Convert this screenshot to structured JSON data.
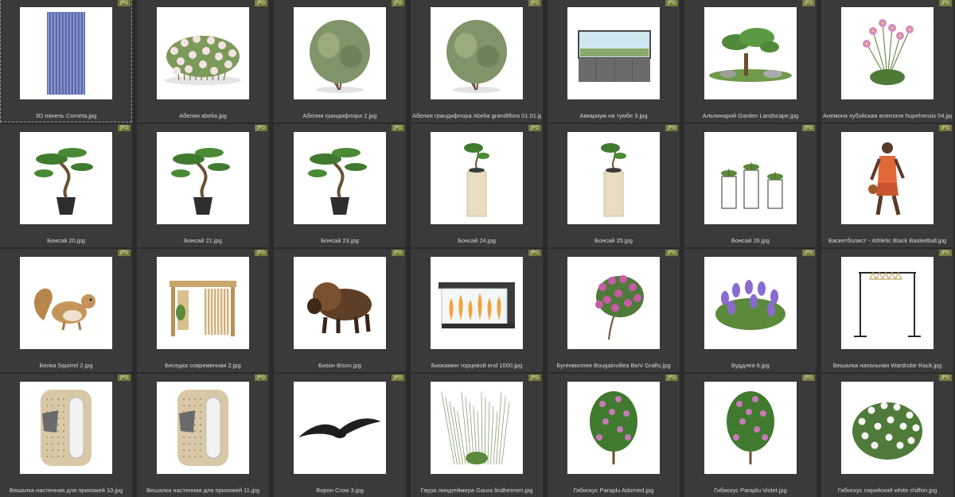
{
  "badge_label": "JPG",
  "files": [
    {
      "name": "3D панель Cometa.jpg",
      "icon": "panel-icon",
      "selected": true
    },
    {
      "name": "Абелия abelia.jpg",
      "icon": "flowering-shrub-icon"
    },
    {
      "name": "Абелия грандифлора 2.jpg",
      "icon": "shrub-icon"
    },
    {
      "name": "Абелия грандифлора Abelia grandiflora 01.01.jpg",
      "icon": "shrub-icon"
    },
    {
      "name": "Аквариум на тумбе 3.jpg",
      "icon": "aquarium-icon"
    },
    {
      "name": "Альпинарий Garden Landscape.jpg",
      "icon": "garden-landscape-icon"
    },
    {
      "name": "Анемона хубэйская anemone hupehensis 04.jpg",
      "icon": "anemone-flower-icon"
    },
    {
      "name": "Бонсай 20.jpg",
      "icon": "bonsai-icon"
    },
    {
      "name": "Бонсай 21.jpg",
      "icon": "bonsai-icon"
    },
    {
      "name": "Бонсай 23.jpg",
      "icon": "bonsai-icon"
    },
    {
      "name": "Бонсай 24.jpg",
      "icon": "bonsai-pedestal-icon"
    },
    {
      "name": "Бонсай 25.jpg",
      "icon": "bonsai-pedestal-icon"
    },
    {
      "name": "Бонсай 26.jpg",
      "icon": "bonsai-stand-icon"
    },
    {
      "name": "Баскетболист - Athletic Black Basketball.jpg",
      "icon": "basketball-player-icon"
    },
    {
      "name": "Белка Squirrel 2.jpg",
      "icon": "squirrel-icon"
    },
    {
      "name": "Беседка современная 2.jpg",
      "icon": "gazebo-icon"
    },
    {
      "name": "Бизон Bison.jpg",
      "icon": "bison-icon"
    },
    {
      "name": "Биокамин торцевой end 1000.jpg",
      "icon": "fireplace-icon"
    },
    {
      "name": "Бугенвиллея Bougainvillea BwV Grafts.jpg",
      "icon": "bougainvillea-icon"
    },
    {
      "name": "Буддлея 6.jpg",
      "icon": "buddleia-icon"
    },
    {
      "name": "Вешалка напольная Wardrobe Rack.jpg",
      "icon": "clothes-rack-icon"
    },
    {
      "name": "Вешалка настенная для прихожей 10.jpg",
      "icon": "wall-hanger-icon"
    },
    {
      "name": "Вешалка настенная для прихожей 11.jpg",
      "icon": "wall-hanger-icon"
    },
    {
      "name": "Ворон Crow 3.jpg",
      "icon": "crow-icon"
    },
    {
      "name": "Гаура линдгеймера Gaura lindheimeri.jpg",
      "icon": "gaura-grass-icon"
    },
    {
      "name": "Гибискус Paraplu Adorned.jpg",
      "icon": "hibiscus-icon"
    },
    {
      "name": "Гибискус Paraplu Violet.jpg",
      "icon": "hibiscus-icon"
    },
    {
      "name": "Гибискус сирийский white chiffon.jpg",
      "icon": "hibiscus-white-icon"
    }
  ]
}
